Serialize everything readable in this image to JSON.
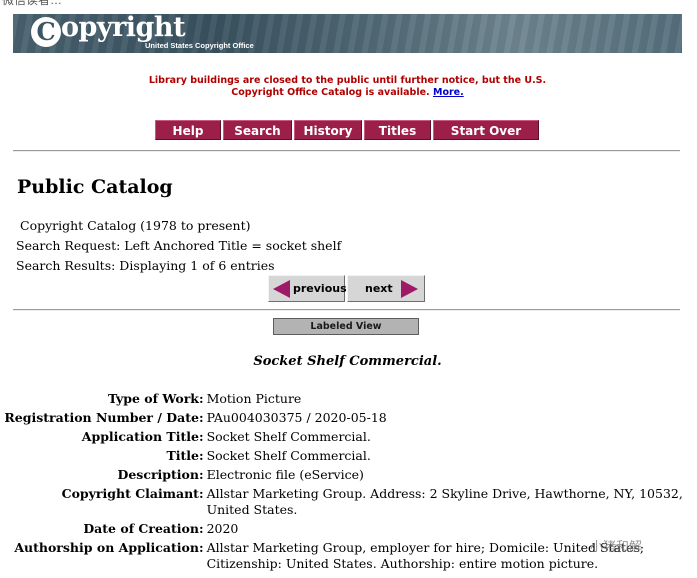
{
  "top_cut_text": "微信读者…",
  "banner": {
    "logo_letter": "C",
    "logo_word": "opyright",
    "logo_sub": "United States Copyright Office"
  },
  "notice": {
    "line1": "Library buildings are closed to the public until further notice, but the U.S.",
    "line2": "Copyright Office Catalog is available.",
    "link": "More."
  },
  "nav": [
    {
      "label": "Help"
    },
    {
      "label": "Search"
    },
    {
      "label": "History"
    },
    {
      "label": "Titles"
    },
    {
      "label": "Start Over"
    }
  ],
  "page_title": "Public Catalog",
  "catalog_line": "Copyright Catalog (1978 to present)",
  "search_request": "Search Request: Left Anchored Title = socket shelf",
  "search_results": "Search Results: Displaying 1 of 6 entries",
  "pager": {
    "previous": "previous",
    "next": "next"
  },
  "labeled_view": "Labeled View",
  "record_title": "Socket Shelf Commercial.",
  "record": [
    {
      "key": "Type of Work:",
      "value": "Motion Picture"
    },
    {
      "key": "Registration Number / Date:",
      "value": "PAu004030375 / 2020-05-18"
    },
    {
      "key": "Application Title:",
      "value": "Socket Shelf Commercial."
    },
    {
      "key": "Title:",
      "value": "Socket Shelf Commercial."
    },
    {
      "key": "Description:",
      "value": "Electronic file (eService)"
    },
    {
      "key": "Copyright Claimant:",
      "value": "Allstar Marketing Group. Address: 2 Skyline Drive, Hawthorne, NY, 10532, United States."
    },
    {
      "key": "Date of Creation:",
      "value": "2020"
    },
    {
      "key": "Authorship on Application:",
      "value": "Allstar Marketing Group, employer for hire; Domicile: United States; Citizenship: United States. Authorship: entire motion picture."
    }
  ],
  "watermark": "小猪和解",
  "colors": {
    "nav_bg": "#9b1f48",
    "notice_red": "#b10000",
    "arrow": "#9e1a68"
  }
}
